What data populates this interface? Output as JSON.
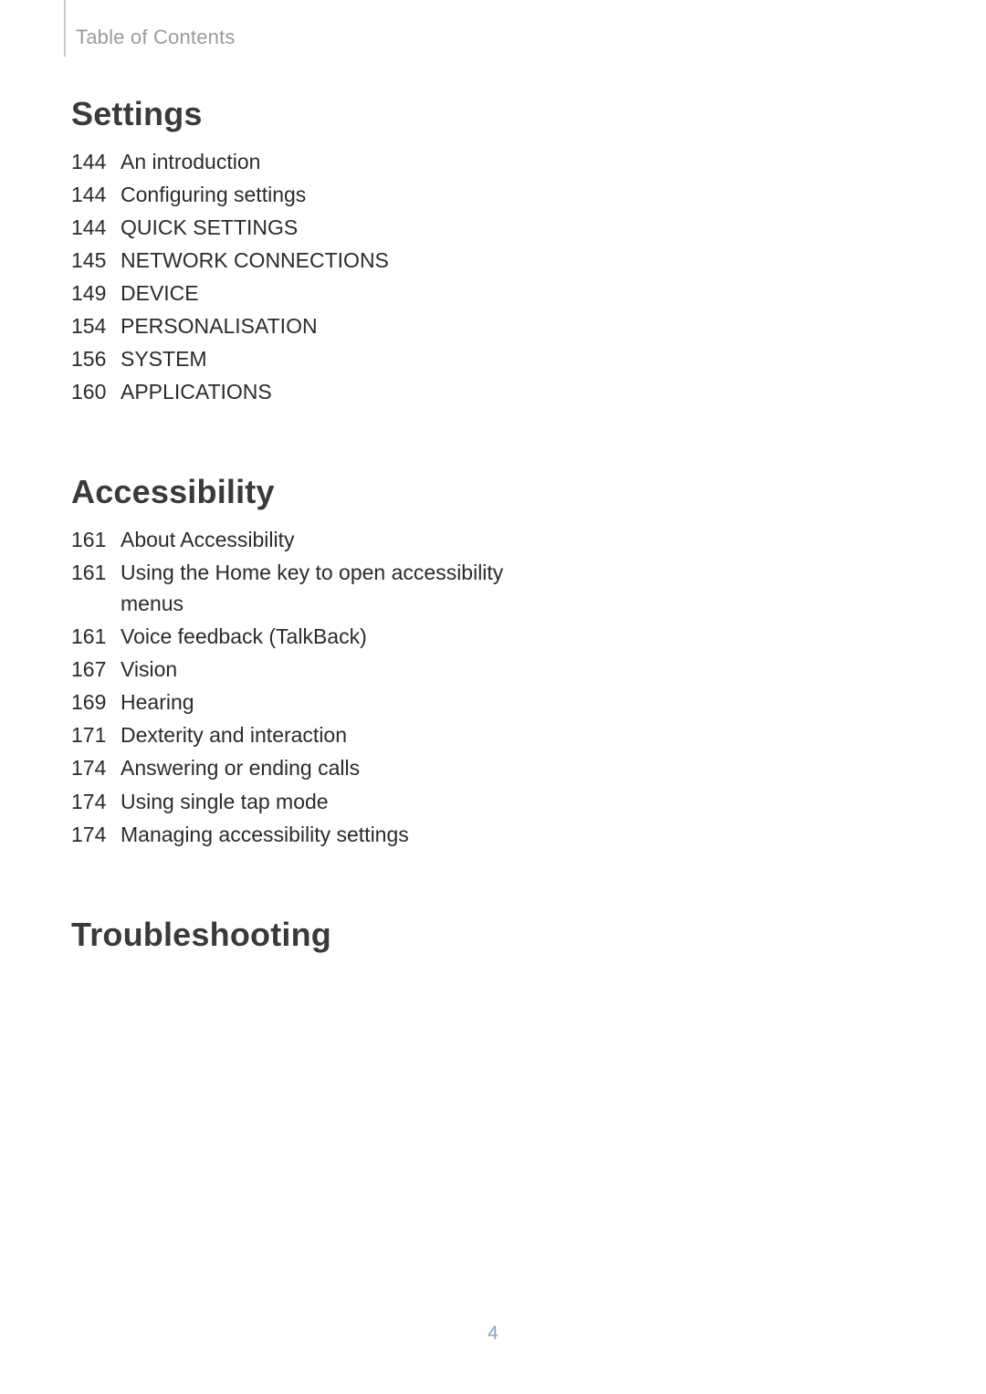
{
  "header": {
    "title": "Table of Contents"
  },
  "sections": [
    {
      "title": "Settings",
      "items": [
        {
          "page": "144",
          "label": "An introduction"
        },
        {
          "page": "144",
          "label": "Configuring settings"
        },
        {
          "page": "144",
          "label": "QUICK SETTINGS"
        },
        {
          "page": "145",
          "label": "NETWORK CONNECTIONS"
        },
        {
          "page": "149",
          "label": "DEVICE"
        },
        {
          "page": "154",
          "label": "PERSONALISATION"
        },
        {
          "page": "156",
          "label": "SYSTEM"
        },
        {
          "page": "160",
          "label": "APPLICATIONS"
        }
      ]
    },
    {
      "title": "Accessibility",
      "items": [
        {
          "page": "161",
          "label": "About Accessibility"
        },
        {
          "page": "161",
          "label": "Using the Home key to open accessibility menus"
        },
        {
          "page": "161",
          "label": "Voice feedback (TalkBack)"
        },
        {
          "page": "167",
          "label": "Vision"
        },
        {
          "page": "169",
          "label": "Hearing"
        },
        {
          "page": "171",
          "label": "Dexterity and interaction"
        },
        {
          "page": "174",
          "label": "Answering or ending calls"
        },
        {
          "page": "174",
          "label": "Using single tap mode"
        },
        {
          "page": "174",
          "label": "Managing accessibility settings"
        }
      ]
    },
    {
      "title": "Troubleshooting",
      "items": []
    }
  ],
  "footer": {
    "page_number": "4"
  }
}
